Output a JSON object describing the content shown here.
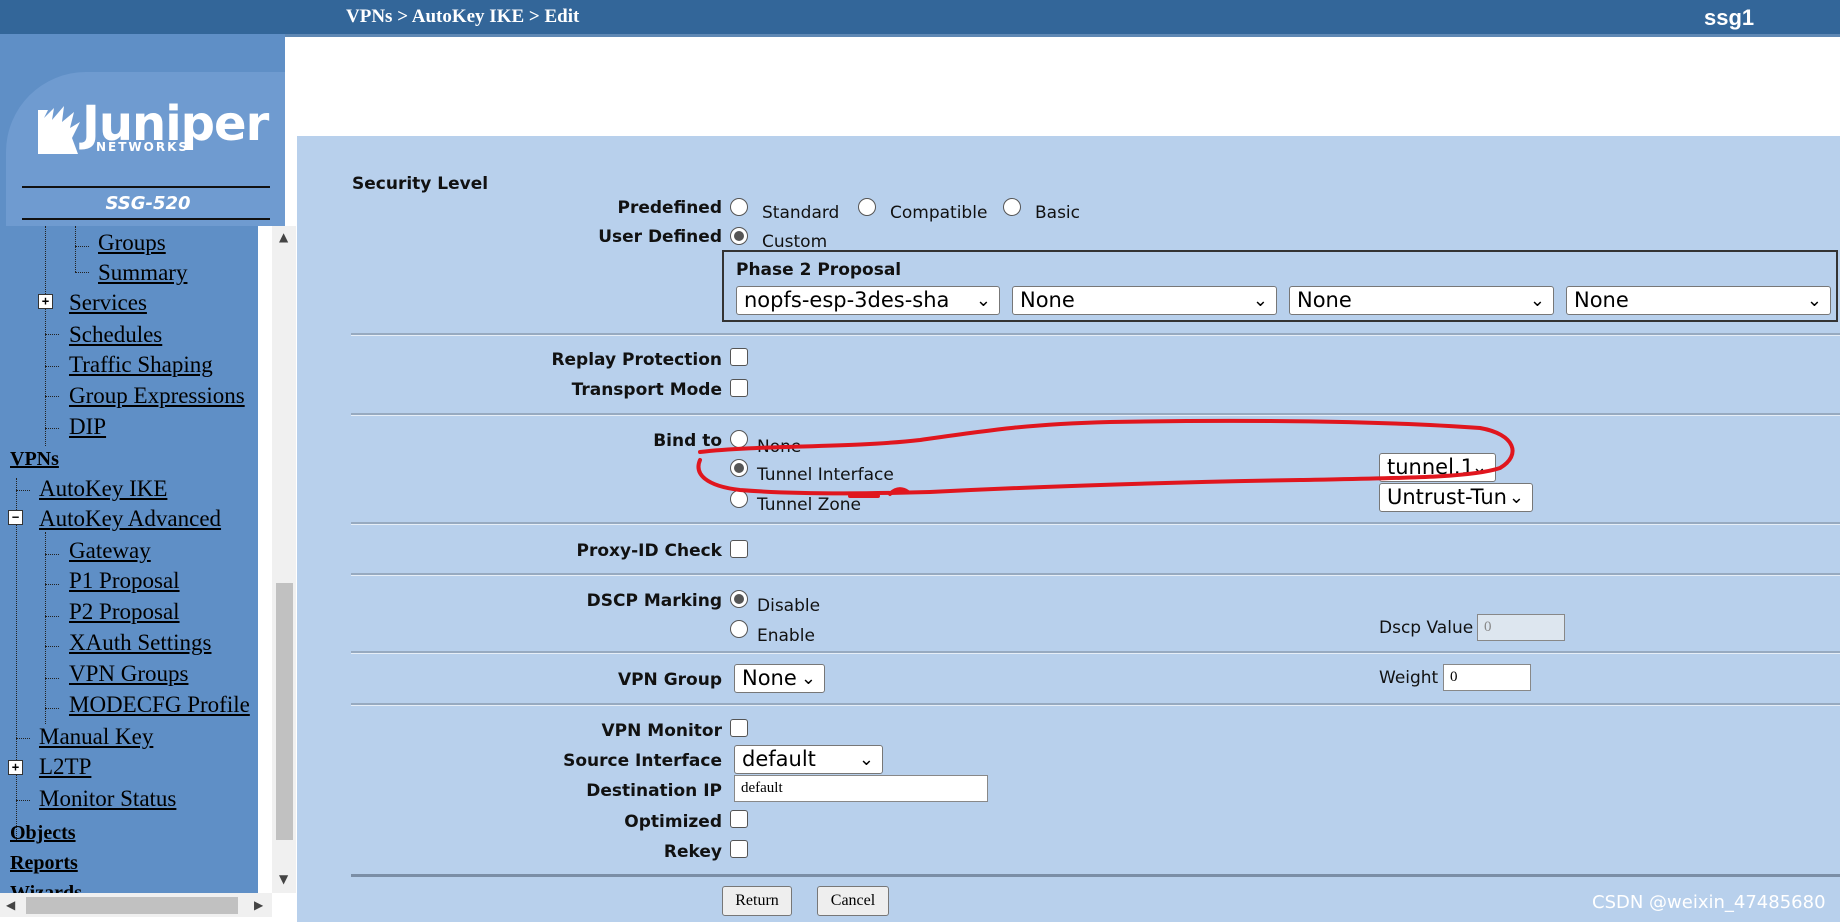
{
  "header": {
    "breadcrumb": "VPNs > AutoKey IKE > Edit",
    "device": "ssg1"
  },
  "brand": {
    "logo_text": "Juniper",
    "logo_sub": "NETWORKS",
    "model": "SSG-520"
  },
  "nav": {
    "groups": "Groups",
    "summary": "Summary",
    "services": "Services",
    "schedules": "Schedules",
    "traffic_shaping": "Traffic Shaping",
    "group_expressions": "Group Expressions",
    "dip": "DIP",
    "vpns": "VPNs",
    "autokey_ike": "AutoKey IKE",
    "autokey_advanced": "AutoKey Advanced",
    "gateway": "Gateway",
    "p1_proposal": "P1 Proposal",
    "p2_proposal": "P2 Proposal",
    "xauth_settings": "XAuth Settings",
    "vpn_groups": "VPN Groups",
    "modecfg_profile": "MODECFG Profile",
    "manual_key": "Manual Key",
    "l2tp": "L2TP",
    "monitor_status": "Monitor Status",
    "objects": "Objects",
    "reports": "Reports",
    "wizards": "Wizards",
    "plus": "+",
    "minus": "−"
  },
  "form": {
    "security_level": "Security Level",
    "predefined": "Predefined",
    "standard": "Standard",
    "compatible": "Compatible",
    "basic": "Basic",
    "user_defined": "User Defined",
    "custom": "Custom",
    "phase2_proposal": "Phase 2 Proposal",
    "p2_selects": [
      "nopfs-esp-3des-sha",
      "None",
      "None",
      "None"
    ],
    "replay_protection": "Replay Protection",
    "transport_mode": "Transport Mode",
    "bind_to": "Bind to",
    "bind_none": "None",
    "tunnel_interface": "Tunnel Interface",
    "tunnel_zone": "Tunnel Zone",
    "tunnel_interface_value": "tunnel.1",
    "tunnel_zone_value": "Untrust-Tun",
    "proxy_id_check": "Proxy-ID Check",
    "dscp_marking": "DSCP Marking",
    "disable": "Disable",
    "enable": "Enable",
    "dscp_value_label": "Dscp Value",
    "dscp_value": "0",
    "vpn_group": "VPN Group",
    "vpn_group_value": "None",
    "weight_label": "Weight",
    "weight_value": "0",
    "vpn_monitor": "VPN Monitor",
    "source_interface": "Source Interface",
    "source_interface_value": "default",
    "destination_ip": "Destination IP",
    "destination_ip_value": "default",
    "optimized": "Optimized",
    "rekey": "Rekey",
    "return": "Return",
    "cancel": "Cancel",
    "chevron": "⌄"
  },
  "watermark": "CSDN @weixin_47485680",
  "colors": {
    "header": "#336699",
    "sidebar": "#5f8fc6",
    "content": "#b8d0ec",
    "annotation": "#e0161e"
  }
}
